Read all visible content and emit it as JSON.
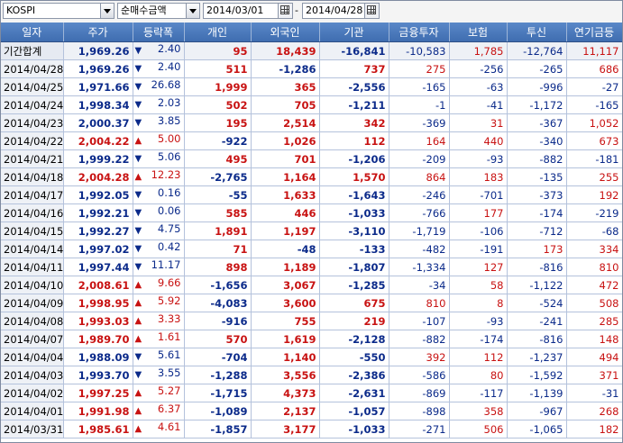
{
  "toolbar": {
    "market": "KOSPI",
    "metric": "순매수금액",
    "date_from": "2014/03/01",
    "date_to": "2014/04/28"
  },
  "columns": [
    "일자",
    "주가",
    "등락폭",
    "개인",
    "외국인",
    "기관",
    "금융투자",
    "보험",
    "투신",
    "연기금등"
  ],
  "colors": {
    "up": "#c81212",
    "down": "#0b2a8a",
    "header": "#4a78bc"
  },
  "rows": [
    {
      "date": "기간합계",
      "close": "1,969.26",
      "dir": "down",
      "change": "2.40",
      "personal": "95",
      "foreign": "18,439",
      "inst": "-16,841",
      "fin": "-10,583",
      "ins": "1,785",
      "trust": "-12,764",
      "pension": "11,117"
    },
    {
      "date": "2014/04/28",
      "close": "1,969.26",
      "dir": "down",
      "change": "2.40",
      "personal": "511",
      "foreign": "-1,286",
      "inst": "737",
      "fin": "275",
      "ins": "-256",
      "trust": "-265",
      "pension": "686"
    },
    {
      "date": "2014/04/25",
      "close": "1,971.66",
      "dir": "down",
      "change": "26.68",
      "personal": "1,999",
      "foreign": "365",
      "inst": "-2,556",
      "fin": "-165",
      "ins": "-63",
      "trust": "-996",
      "pension": "-27"
    },
    {
      "date": "2014/04/24",
      "close": "1,998.34",
      "dir": "down",
      "change": "2.03",
      "personal": "502",
      "foreign": "705",
      "inst": "-1,211",
      "fin": "-1",
      "ins": "-41",
      "trust": "-1,172",
      "pension": "-165"
    },
    {
      "date": "2014/04/23",
      "close": "2,000.37",
      "dir": "down",
      "change": "3.85",
      "personal": "195",
      "foreign": "2,514",
      "inst": "342",
      "fin": "-369",
      "ins": "31",
      "trust": "-367",
      "pension": "1,052"
    },
    {
      "date": "2014/04/22",
      "close": "2,004.22",
      "dir": "up",
      "change": "5.00",
      "personal": "-922",
      "foreign": "1,026",
      "inst": "112",
      "fin": "164",
      "ins": "440",
      "trust": "-340",
      "pension": "673"
    },
    {
      "date": "2014/04/21",
      "close": "1,999.22",
      "dir": "down",
      "change": "5.06",
      "personal": "495",
      "foreign": "701",
      "inst": "-1,206",
      "fin": "-209",
      "ins": "-93",
      "trust": "-882",
      "pension": "-181"
    },
    {
      "date": "2014/04/18",
      "close": "2,004.28",
      "dir": "up",
      "change": "12.23",
      "personal": "-2,765",
      "foreign": "1,164",
      "inst": "1,570",
      "fin": "864",
      "ins": "183",
      "trust": "-135",
      "pension": "255"
    },
    {
      "date": "2014/04/17",
      "close": "1,992.05",
      "dir": "down",
      "change": "0.16",
      "personal": "-55",
      "foreign": "1,633",
      "inst": "-1,643",
      "fin": "-246",
      "ins": "-701",
      "trust": "-373",
      "pension": "192"
    },
    {
      "date": "2014/04/16",
      "close": "1,992.21",
      "dir": "down",
      "change": "0.06",
      "personal": "585",
      "foreign": "446",
      "inst": "-1,033",
      "fin": "-766",
      "ins": "177",
      "trust": "-174",
      "pension": "-219"
    },
    {
      "date": "2014/04/15",
      "close": "1,992.27",
      "dir": "down",
      "change": "4.75",
      "personal": "1,891",
      "foreign": "1,197",
      "inst": "-3,110",
      "fin": "-1,719",
      "ins": "-106",
      "trust": "-712",
      "pension": "-68"
    },
    {
      "date": "2014/04/14",
      "close": "1,997.02",
      "dir": "down",
      "change": "0.42",
      "personal": "71",
      "foreign": "-48",
      "inst": "-133",
      "fin": "-482",
      "ins": "-191",
      "trust": "173",
      "pension": "334"
    },
    {
      "date": "2014/04/11",
      "close": "1,997.44",
      "dir": "down",
      "change": "11.17",
      "personal": "898",
      "foreign": "1,189",
      "inst": "-1,807",
      "fin": "-1,334",
      "ins": "127",
      "trust": "-816",
      "pension": "810"
    },
    {
      "date": "2014/04/10",
      "close": "2,008.61",
      "dir": "up",
      "change": "9.66",
      "personal": "-1,656",
      "foreign": "3,067",
      "inst": "-1,285",
      "fin": "-34",
      "ins": "58",
      "trust": "-1,122",
      "pension": "472"
    },
    {
      "date": "2014/04/09",
      "close": "1,998.95",
      "dir": "up",
      "change": "5.92",
      "personal": "-4,083",
      "foreign": "3,600",
      "inst": "675",
      "fin": "810",
      "ins": "8",
      "trust": "-524",
      "pension": "508"
    },
    {
      "date": "2014/04/08",
      "close": "1,993.03",
      "dir": "up",
      "change": "3.33",
      "personal": "-916",
      "foreign": "755",
      "inst": "219",
      "fin": "-107",
      "ins": "-93",
      "trust": "-241",
      "pension": "285"
    },
    {
      "date": "2014/04/07",
      "close": "1,989.70",
      "dir": "up",
      "change": "1.61",
      "personal": "570",
      "foreign": "1,619",
      "inst": "-2,128",
      "fin": "-882",
      "ins": "-174",
      "trust": "-816",
      "pension": "148"
    },
    {
      "date": "2014/04/04",
      "close": "1,988.09",
      "dir": "down",
      "change": "5.61",
      "personal": "-704",
      "foreign": "1,140",
      "inst": "-550",
      "fin": "392",
      "ins": "112",
      "trust": "-1,237",
      "pension": "494"
    },
    {
      "date": "2014/04/03",
      "close": "1,993.70",
      "dir": "down",
      "change": "3.55",
      "personal": "-1,288",
      "foreign": "3,556",
      "inst": "-2,386",
      "fin": "-586",
      "ins": "80",
      "trust": "-1,592",
      "pension": "371"
    },
    {
      "date": "2014/04/02",
      "close": "1,997.25",
      "dir": "up",
      "change": "5.27",
      "personal": "-1,715",
      "foreign": "4,373",
      "inst": "-2,631",
      "fin": "-869",
      "ins": "-117",
      "trust": "-1,139",
      "pension": "-31"
    },
    {
      "date": "2014/04/01",
      "close": "1,991.98",
      "dir": "up",
      "change": "6.37",
      "personal": "-1,089",
      "foreign": "2,137",
      "inst": "-1,057",
      "fin": "-898",
      "ins": "358",
      "trust": "-967",
      "pension": "268"
    },
    {
      "date": "2014/03/31",
      "close": "1,985.61",
      "dir": "up",
      "change": "4.61",
      "personal": "-1,857",
      "foreign": "3,177",
      "inst": "-1,033",
      "fin": "-271",
      "ins": "506",
      "trust": "-1,065",
      "pension": "182"
    }
  ]
}
